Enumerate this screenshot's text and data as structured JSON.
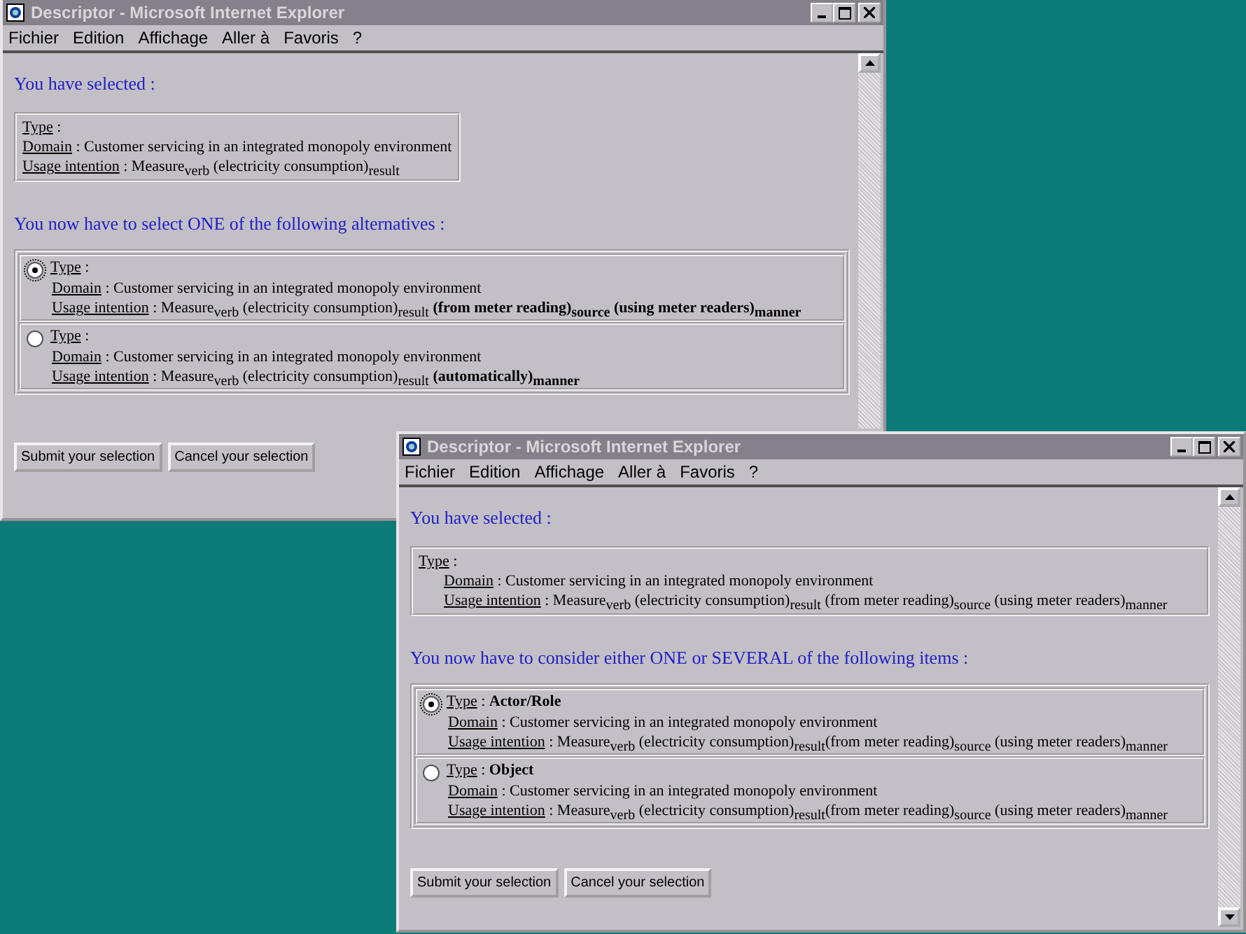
{
  "windows": [
    {
      "title": "Descriptor  - Microsoft Internet Explorer",
      "active": false,
      "menu": [
        {
          "label": "Fichier"
        },
        {
          "label": "Edition"
        },
        {
          "label": "Affichage"
        },
        {
          "label": "Aller à"
        },
        {
          "label": "Favoris"
        },
        {
          "label": "?"
        }
      ],
      "selected_heading": "You have selected :",
      "selected": {
        "indent_details": false,
        "lines": [
          {
            "label": "Type",
            "text": ":"
          },
          {
            "label": "Domain",
            "text": ": Customer servicing in an integrated monopoly environment"
          },
          {
            "label": "Usage intention",
            "text": ": Measure$_{verb}$ (electricity consumption)$_{result}$"
          }
        ]
      },
      "prompt": "You now have to select ONE of the following alternatives :",
      "alternatives": [
        {
          "selected": true,
          "focused": true,
          "lines": [
            {
              "label": "Type",
              "text": ":"
            },
            {
              "label": "Domain",
              "text": ": Customer servicing in an integrated monopoly environment"
            },
            {
              "label": "Usage intention",
              "text": ": Measure$_{verb}$ (electricity consumption)$_{result}$ **(from meter reading)$_{source}$ (using meter readers)$_{manner}$**"
            }
          ]
        },
        {
          "selected": false,
          "focused": false,
          "lines": [
            {
              "label": "Type",
              "text": ":"
            },
            {
              "label": "Domain",
              "text": ": Customer servicing in an integrated monopoly environment"
            },
            {
              "label": "Usage intention",
              "text": ": Measure$_{verb}$ (electricity consumption)$_{result}$ **(automatically)$_{manner}$**"
            }
          ]
        }
      ],
      "buttons": [
        "Submit your selection",
        "Cancel your selection"
      ]
    },
    {
      "title": "Descriptor  - Microsoft Internet Explorer",
      "active": false,
      "menu": [
        {
          "label": "Fichier"
        },
        {
          "label": "Edition"
        },
        {
          "label": "Affichage"
        },
        {
          "label": "Aller à"
        },
        {
          "label": "Favoris"
        },
        {
          "label": "?"
        }
      ],
      "selected_heading": "You have selected :",
      "selected": {
        "indent_details": true,
        "lines": [
          {
            "label": "Type",
            "text": ":"
          },
          {
            "label": "Domain",
            "text": ": Customer servicing in an integrated monopoly environment"
          },
          {
            "label": "Usage intention",
            "text": ": Measure$_{verb}$ (electricity consumption)$_{result}$ (from meter reading)$_{source}$ (using meter readers)$_{manner}$"
          }
        ]
      },
      "prompt": "You now have to consider either ONE or SEVERAL of the following items :",
      "alternatives": [
        {
          "selected": true,
          "focused": true,
          "lines": [
            {
              "label": "Type",
              "text": ": **Actor/Role**"
            },
            {
              "label": "Domain",
              "text": ": Customer servicing in an integrated monopoly environment"
            },
            {
              "label": "Usage intention",
              "text": ": Measure$_{verb}$ (electricity consumption)$_{result}$(from meter reading)$_{source}$ (using meter readers)$_{manner}$"
            }
          ]
        },
        {
          "selected": false,
          "focused": false,
          "lines": [
            {
              "label": "Type",
              "text": ": **Object**"
            },
            {
              "label": "Domain",
              "text": ": Customer servicing in an integrated monopoly environment"
            },
            {
              "label": "Usage intention",
              "text": ": Measure$_{verb}$ (electricity consumption)$_{result}$(from meter reading)$_{source}$ (using meter readers)$_{manner}$"
            }
          ]
        }
      ],
      "buttons": [
        "Submit your selection",
        "Cancel your selection"
      ]
    }
  ]
}
